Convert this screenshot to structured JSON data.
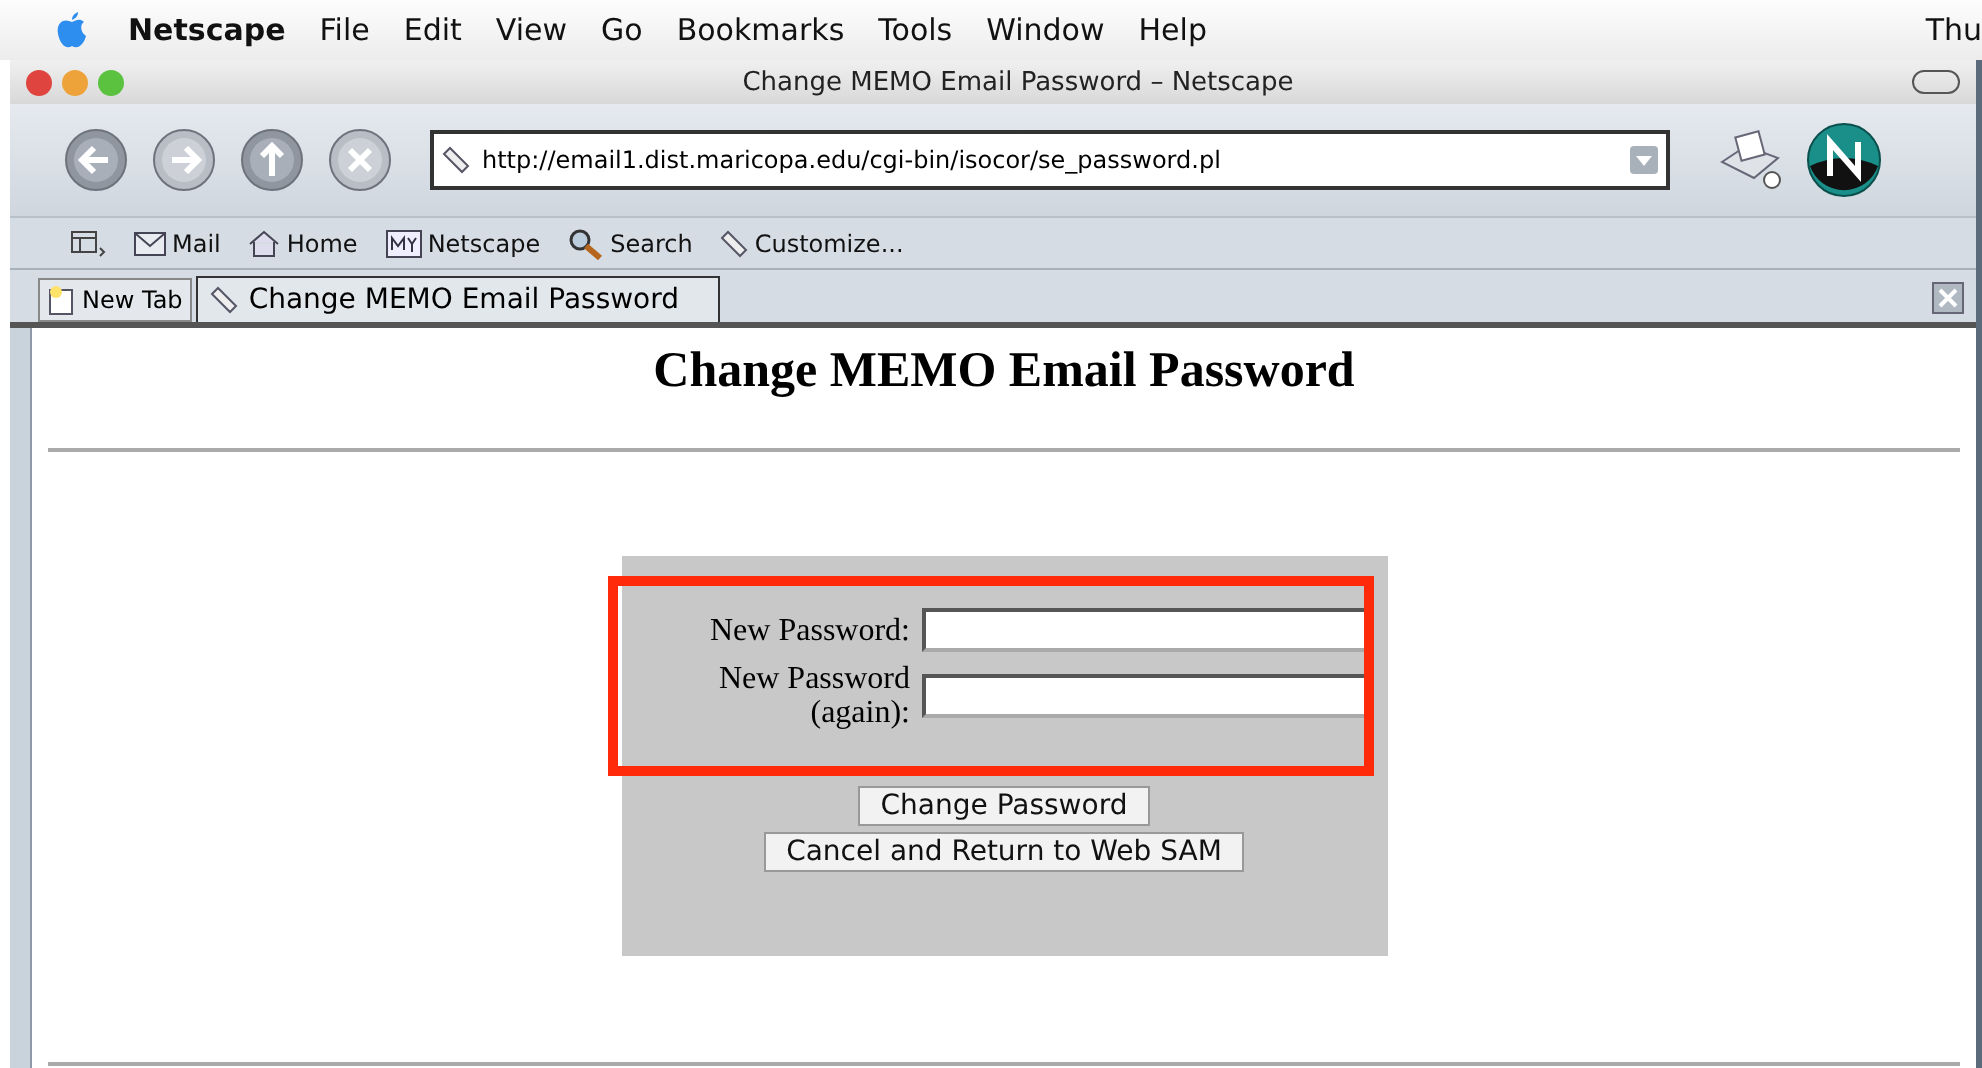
{
  "menu_bar": {
    "items": [
      "Netscape",
      "File",
      "Edit",
      "View",
      "Go",
      "Bookmarks",
      "Tools",
      "Window",
      "Help"
    ],
    "clock": "Thu"
  },
  "window": {
    "title": "Change MEMO Email Password – Netscape"
  },
  "toolbar": {
    "url": "http://email1.dist.maricopa.edu/cgi-bin/isocor/se_password.pl"
  },
  "personal_toolbar": [
    {
      "label": "Mail",
      "kind": "mail"
    },
    {
      "label": "Home",
      "kind": "home"
    },
    {
      "label": "Netscape",
      "kind": "my"
    },
    {
      "label": "Search",
      "kind": "search"
    },
    {
      "label": "Customize...",
      "kind": "bookmark"
    }
  ],
  "new_tab_button": "New Tab",
  "tabs": [
    {
      "label": "Change MEMO Email Password",
      "selected": true
    }
  ],
  "page": {
    "heading": "Change MEMO Email Password",
    "fields": [
      {
        "label": "New Password:"
      },
      {
        "label": "New Password (again):"
      }
    ],
    "buttons": [
      "Change Password",
      "Cancel and Return to Web SAM"
    ]
  }
}
